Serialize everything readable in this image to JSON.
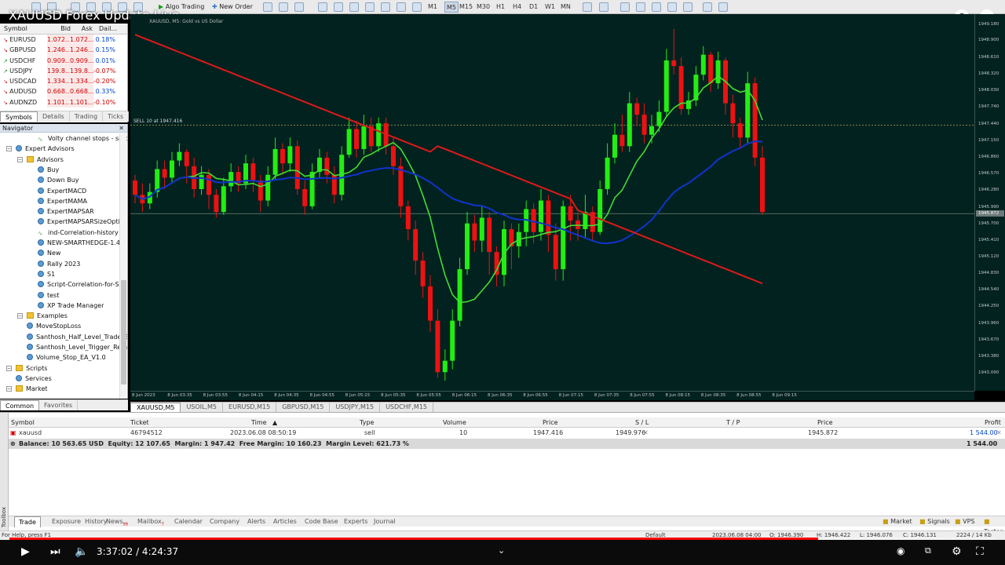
{
  "video": {
    "title": "XAUUSD Forex Update Live",
    "time_current": "3:37:02",
    "time_total": "4:24:37",
    "time_display": "3:37:02 / 4:24:37",
    "progress": 0.82
  },
  "toolbar": {
    "algo_trading": "Algo Trading",
    "new_order": "New Order",
    "timeframes": [
      "M1",
      "M5",
      "M15",
      "M30",
      "H1",
      "H4",
      "D1",
      "W1",
      "MN"
    ],
    "active_timeframe": "M5"
  },
  "market_watch": {
    "columns": [
      "Symbol",
      "Bid",
      "Ask",
      "Dail..."
    ],
    "rows": [
      {
        "symbol": "EURUSD",
        "bid": "1.072...",
        "ask": "1.072...",
        "daily": "0.18%",
        "dir": "down"
      },
      {
        "symbol": "GBPUSD",
        "bid": "1.246...",
        "ask": "1.246...",
        "daily": "0.15%",
        "dir": "down"
      },
      {
        "symbol": "USDCHF",
        "bid": "0.909...",
        "ask": "0.909...",
        "daily": "0.01%",
        "dir": "up"
      },
      {
        "symbol": "USDJPY",
        "bid": "139.8...",
        "ask": "139.8...",
        "daily": "-0.07%",
        "dir": "up"
      },
      {
        "symbol": "USDCAD",
        "bid": "1.334...",
        "ask": "1.334...",
        "daily": "-0.20%",
        "dir": "down"
      },
      {
        "symbol": "AUDUSD",
        "bid": "0.668...",
        "ask": "0.668...",
        "daily": "0.33%",
        "dir": "down"
      },
      {
        "symbol": "AUDNZD",
        "bid": "1.101...",
        "ask": "1.101...",
        "daily": "-0.10%",
        "dir": "down"
      }
    ],
    "tabs": [
      "Symbols",
      "Details",
      "Trading",
      "Ticks"
    ]
  },
  "navigator": {
    "title": "Navigator",
    "items": [
      {
        "label": "Volty channel stops - smooth",
        "kind": "ind",
        "level": 2
      },
      {
        "label": "Expert Advisors",
        "kind": "ea",
        "level": 0
      },
      {
        "label": "Advisors",
        "kind": "folder",
        "level": 1
      },
      {
        "label": "Buy",
        "kind": "ea",
        "level": 2
      },
      {
        "label": "Down Buy",
        "kind": "ea",
        "level": 2
      },
      {
        "label": "ExpertMACD",
        "kind": "ea",
        "level": 2
      },
      {
        "label": "ExpertMAMA",
        "kind": "ea",
        "level": 2
      },
      {
        "label": "ExpertMAPSAR",
        "kind": "ea",
        "level": 2
      },
      {
        "label": "ExpertMAPSARSizeOptim",
        "kind": "ea",
        "level": 2
      },
      {
        "label": "ind-Correlation-history",
        "kind": "ind",
        "level": 2
      },
      {
        "label": "NEW-SMARTHEDGE-1.4",
        "kind": "ea",
        "level": 2
      },
      {
        "label": "New",
        "kind": "ea",
        "level": 2
      },
      {
        "label": "Rally 2023",
        "kind": "ea",
        "level": 2
      },
      {
        "label": "S1",
        "kind": "ea",
        "level": 2
      },
      {
        "label": "Script-Correlation-for-SM",
        "kind": "ea",
        "level": 2
      },
      {
        "label": "test",
        "kind": "ea",
        "level": 2
      },
      {
        "label": "XP Trade Manager",
        "kind": "ea",
        "level": 2
      },
      {
        "label": "Examples",
        "kind": "folder",
        "level": 1
      },
      {
        "label": "MoveStopLoss",
        "kind": "ea",
        "level": 1
      },
      {
        "label": "Santhosh_Half_Level_Trade_E",
        "kind": "ea",
        "level": 1
      },
      {
        "label": "Santhosh_Level_Trigger_Rem",
        "kind": "ea",
        "level": 1
      },
      {
        "label": "Volume_Stop_EA_V1.0",
        "kind": "ea",
        "level": 1
      },
      {
        "label": "Scripts",
        "kind": "folder",
        "level": 0
      },
      {
        "label": "Services",
        "kind": "ea",
        "level": 0
      },
      {
        "label": "Market",
        "kind": "folder",
        "level": 0
      }
    ],
    "tabs": [
      "Common",
      "Favorites"
    ]
  },
  "chart": {
    "title": "XAUUSD, M5: Gold vs US Dollar",
    "sell_label": "SELL 10 at 1947.416",
    "current_price": "1945.872",
    "price_ticks": [
      "1949.180",
      "1948.900",
      "1948.610",
      "1948.320",
      "1948.030",
      "1947.740",
      "1947.440",
      "1947.150",
      "1946.860",
      "1946.570",
      "1946.280",
      "1945.990",
      "1945.700",
      "1945.410",
      "1945.120",
      "1944.830",
      "1944.540",
      "1944.250",
      "1943.960",
      "1943.670",
      "1943.380",
      "1943.090"
    ],
    "time_ticks": [
      "8 Jun 2023",
      "8 Jun 03:35",
      "8 Jun 03:55",
      "8 Jun 04:15",
      "8 Jun 04:35",
      "8 Jun 04:55",
      "8 Jun 05:15",
      "8 Jun 05:35",
      "8 Jun 05:55",
      "8 Jun 06:15",
      "8 Jun 06:35",
      "8 Jun 06:55",
      "8 Jun 07:15",
      "8 Jun 07:35",
      "8 Jun 07:55",
      "8 Jun 08:15",
      "8 Jun 08:35",
      "8 Jun 08:55",
      "8 Jun 09:15"
    ],
    "tabs": [
      "XAUUSD,M5",
      "USOIL,M5",
      "EURUSD,M15",
      "GBPUSD,M15",
      "USDJPY,M15",
      "USDCHF,M15"
    ],
    "colors": {
      "bg": "#01221f",
      "bull": "#22ee11",
      "bear": "#ee1111",
      "ma_fast": "#44dd33",
      "ma_mid": "#1133cc",
      "ma_slow": "#dd1a1a"
    }
  },
  "chart_data": {
    "type": "candlestick",
    "symbol": "XAUUSD",
    "timeframe": "M5",
    "y_range": [
      1942.9,
      1949.3
    ],
    "sell_level": 1947.416,
    "current_price": 1945.872,
    "candles": [
      {
        "o": 1946.45,
        "c": 1946.2,
        "h": 1946.55,
        "l": 1946.05
      },
      {
        "o": 1946.2,
        "c": 1946.05,
        "h": 1946.4,
        "l": 1945.9
      },
      {
        "o": 1946.05,
        "c": 1946.25,
        "h": 1946.4,
        "l": 1945.95
      },
      {
        "o": 1946.25,
        "c": 1946.65,
        "h": 1946.8,
        "l": 1946.15
      },
      {
        "o": 1946.65,
        "c": 1946.5,
        "h": 1946.8,
        "l": 1946.3
      },
      {
        "o": 1946.5,
        "c": 1946.8,
        "h": 1946.95,
        "l": 1946.4
      },
      {
        "o": 1946.8,
        "c": 1946.95,
        "h": 1947.1,
        "l": 1946.7
      },
      {
        "o": 1946.95,
        "c": 1946.7,
        "h": 1947.0,
        "l": 1946.4
      },
      {
        "o": 1946.7,
        "c": 1946.3,
        "h": 1946.85,
        "l": 1946.15
      },
      {
        "o": 1946.3,
        "c": 1946.55,
        "h": 1946.7,
        "l": 1946.2
      },
      {
        "o": 1946.55,
        "c": 1946.2,
        "h": 1946.65,
        "l": 1945.95
      },
      {
        "o": 1946.2,
        "c": 1945.9,
        "h": 1946.3,
        "l": 1945.8
      },
      {
        "o": 1945.9,
        "c": 1946.35,
        "h": 1946.5,
        "l": 1945.85
      },
      {
        "o": 1946.35,
        "c": 1946.6,
        "h": 1946.75,
        "l": 1946.25
      },
      {
        "o": 1946.6,
        "c": 1946.4,
        "h": 1946.7,
        "l": 1946.25
      },
      {
        "o": 1946.4,
        "c": 1946.75,
        "h": 1946.9,
        "l": 1946.3
      },
      {
        "o": 1946.75,
        "c": 1946.45,
        "h": 1946.85,
        "l": 1946.25
      },
      {
        "o": 1946.45,
        "c": 1946.1,
        "h": 1946.55,
        "l": 1945.9
      },
      {
        "o": 1946.1,
        "c": 1946.55,
        "h": 1946.7,
        "l": 1946.0
      },
      {
        "o": 1946.55,
        "c": 1947.0,
        "h": 1947.2,
        "l": 1946.45
      },
      {
        "o": 1947.0,
        "c": 1946.75,
        "h": 1947.1,
        "l": 1946.55
      },
      {
        "o": 1946.75,
        "c": 1947.05,
        "h": 1947.2,
        "l": 1946.6
      },
      {
        "o": 1947.05,
        "c": 1946.3,
        "h": 1947.15,
        "l": 1946.2
      },
      {
        "o": 1946.3,
        "c": 1946.0,
        "h": 1946.45,
        "l": 1945.85
      },
      {
        "o": 1946.0,
        "c": 1946.6,
        "h": 1946.75,
        "l": 1945.95
      },
      {
        "o": 1946.6,
        "c": 1946.85,
        "h": 1947.0,
        "l": 1946.5
      },
      {
        "o": 1946.85,
        "c": 1946.55,
        "h": 1946.95,
        "l": 1946.4
      },
      {
        "o": 1946.55,
        "c": 1946.2,
        "h": 1946.7,
        "l": 1946.05
      },
      {
        "o": 1946.2,
        "c": 1946.9,
        "h": 1947.05,
        "l": 1946.1
      },
      {
        "o": 1946.9,
        "c": 1947.35,
        "h": 1947.55,
        "l": 1946.85
      },
      {
        "o": 1947.35,
        "c": 1947.0,
        "h": 1947.5,
        "l": 1946.85
      },
      {
        "o": 1947.0,
        "c": 1947.4,
        "h": 1947.6,
        "l": 1946.9
      },
      {
        "o": 1947.4,
        "c": 1947.05,
        "h": 1947.55,
        "l": 1946.95
      },
      {
        "o": 1947.05,
        "c": 1947.45,
        "h": 1947.55,
        "l": 1946.95
      },
      {
        "o": 1947.45,
        "c": 1947.05,
        "h": 1947.55,
        "l": 1946.9
      },
      {
        "o": 1947.05,
        "c": 1946.7,
        "h": 1947.2,
        "l": 1946.55
      },
      {
        "o": 1946.7,
        "c": 1946.0,
        "h": 1946.85,
        "l": 1945.8
      },
      {
        "o": 1946.0,
        "c": 1945.6,
        "h": 1946.1,
        "l": 1945.4
      },
      {
        "o": 1945.6,
        "c": 1945.05,
        "h": 1945.75,
        "l": 1944.8
      },
      {
        "o": 1945.05,
        "c": 1944.6,
        "h": 1945.2,
        "l": 1944.4
      },
      {
        "o": 1944.6,
        "c": 1944.0,
        "h": 1944.8,
        "l": 1943.8
      },
      {
        "o": 1944.0,
        "c": 1943.1,
        "h": 1944.2,
        "l": 1943.0
      },
      {
        "o": 1943.1,
        "c": 1943.3,
        "h": 1943.5,
        "l": 1942.95
      },
      {
        "o": 1943.3,
        "c": 1944.0,
        "h": 1944.2,
        "l": 1943.15
      },
      {
        "o": 1944.0,
        "c": 1944.9,
        "h": 1945.1,
        "l": 1943.9
      },
      {
        "o": 1944.9,
        "c": 1945.7,
        "h": 1945.9,
        "l": 1944.8
      },
      {
        "o": 1945.7,
        "c": 1945.4,
        "h": 1945.85,
        "l": 1945.2
      },
      {
        "o": 1945.4,
        "c": 1945.8,
        "h": 1946.0,
        "l": 1945.2
      },
      {
        "o": 1945.8,
        "c": 1945.2,
        "h": 1945.9,
        "l": 1944.8
      },
      {
        "o": 1945.2,
        "c": 1944.8,
        "h": 1945.3,
        "l": 1944.6
      },
      {
        "o": 1944.8,
        "c": 1945.6,
        "h": 1945.75,
        "l": 1944.6
      },
      {
        "o": 1945.6,
        "c": 1945.3,
        "h": 1945.7,
        "l": 1944.9
      },
      {
        "o": 1945.3,
        "c": 1945.55,
        "h": 1945.7,
        "l": 1945.1
      },
      {
        "o": 1945.55,
        "c": 1945.95,
        "h": 1946.1,
        "l": 1945.3
      },
      {
        "o": 1945.95,
        "c": 1945.55,
        "h": 1946.05,
        "l": 1945.35
      },
      {
        "o": 1945.55,
        "c": 1946.1,
        "h": 1946.3,
        "l": 1945.4
      },
      {
        "o": 1946.1,
        "c": 1945.5,
        "h": 1946.2,
        "l": 1945.2
      },
      {
        "o": 1945.5,
        "c": 1944.9,
        "h": 1945.7,
        "l": 1944.7
      },
      {
        "o": 1944.9,
        "c": 1946.0,
        "h": 1946.1,
        "l": 1944.7
      },
      {
        "o": 1946.0,
        "c": 1945.75,
        "h": 1946.2,
        "l": 1945.4
      },
      {
        "o": 1945.75,
        "c": 1945.6,
        "h": 1945.9,
        "l": 1945.4
      },
      {
        "o": 1945.6,
        "c": 1945.9,
        "h": 1946.2,
        "l": 1945.45
      },
      {
        "o": 1945.9,
        "c": 1945.55,
        "h": 1946.0,
        "l": 1945.4
      },
      {
        "o": 1945.55,
        "c": 1946.3,
        "h": 1946.45,
        "l": 1945.5
      },
      {
        "o": 1946.3,
        "c": 1946.85,
        "h": 1947.1,
        "l": 1946.2
      },
      {
        "o": 1946.85,
        "c": 1947.25,
        "h": 1947.45,
        "l": 1946.75
      },
      {
        "o": 1947.25,
        "c": 1947.05,
        "h": 1947.6,
        "l": 1946.95
      },
      {
        "o": 1947.05,
        "c": 1947.8,
        "h": 1948.0,
        "l": 1946.95
      },
      {
        "o": 1947.8,
        "c": 1947.6,
        "h": 1947.9,
        "l": 1947.4
      },
      {
        "o": 1947.6,
        "c": 1947.25,
        "h": 1947.8,
        "l": 1947.1
      },
      {
        "o": 1947.25,
        "c": 1947.4,
        "h": 1947.6,
        "l": 1947.1
      },
      {
        "o": 1947.4,
        "c": 1947.65,
        "h": 1947.85,
        "l": 1947.3
      },
      {
        "o": 1947.65,
        "c": 1948.55,
        "h": 1948.75,
        "l": 1947.55
      },
      {
        "o": 1948.55,
        "c": 1948.45,
        "h": 1949.1,
        "l": 1948.3
      },
      {
        "o": 1948.45,
        "c": 1947.7,
        "h": 1948.6,
        "l": 1947.6
      },
      {
        "o": 1947.7,
        "c": 1947.85,
        "h": 1948.0,
        "l": 1947.6
      },
      {
        "o": 1947.85,
        "c": 1948.3,
        "h": 1948.45,
        "l": 1947.75
      },
      {
        "o": 1948.3,
        "c": 1948.65,
        "h": 1948.8,
        "l": 1948.2
      },
      {
        "o": 1948.65,
        "c": 1948.15,
        "h": 1948.7,
        "l": 1948.0
      },
      {
        "o": 1948.15,
        "c": 1948.55,
        "h": 1948.7,
        "l": 1948.05
      },
      {
        "o": 1948.55,
        "c": 1947.8,
        "h": 1948.6,
        "l": 1947.6
      },
      {
        "o": 1947.8,
        "c": 1947.45,
        "h": 1947.95,
        "l": 1947.2
      },
      {
        "o": 1947.45,
        "c": 1947.2,
        "h": 1947.55,
        "l": 1947.0
      },
      {
        "o": 1947.2,
        "c": 1948.15,
        "h": 1948.35,
        "l": 1947.1
      },
      {
        "o": 1948.15,
        "c": 1946.85,
        "h": 1948.25,
        "l": 1946.7
      },
      {
        "o": 1946.85,
        "c": 1945.9,
        "h": 1947.05,
        "l": 1945.85
      }
    ]
  },
  "trade_table": {
    "columns": [
      "Symbol",
      "Ticket",
      "Time",
      "Type",
      "Volume",
      "Price",
      "S / L",
      "T / P",
      "Price",
      "Profit"
    ],
    "row": {
      "symbol": "xauusd",
      "ticket": "46794512",
      "time": "2023.06.08 08:50:19",
      "type": "sell",
      "volume": "10",
      "price": "1947.416",
      "sl": "1949.976",
      "tp": "",
      "price_current": "1945.872",
      "profit": "1 544.00"
    },
    "balance_text": "Balance: 10 563.65 USD  Equity: 12 107.65  Margin: 1 947.42  Free Margin: 10 160.23  Margin Level: 621.73 %",
    "balance_profit": "1 544.00"
  },
  "terminal": {
    "toolbox_label": "Toolbox",
    "tabs": [
      "Trade",
      "Exposure",
      "History",
      "News",
      "Mailbox",
      "Calendar",
      "Company",
      "Alerts",
      "Articles",
      "Code Base",
      "Experts",
      "Journal"
    ],
    "news_badge": "99",
    "mailbox_badge": "7",
    "right_tabs": [
      "Market",
      "Signals",
      "VPS",
      "Tester"
    ]
  },
  "status_bar": {
    "help": "For Help, press F1",
    "profile": "Default",
    "datetime": "2023.06.08 04:00",
    "open": "O: 1946.390",
    "high": "H: 1946.422",
    "low": "L: 1946.076",
    "close": "C: 1946.131",
    "traffic": "2224 / 14 Kb"
  }
}
